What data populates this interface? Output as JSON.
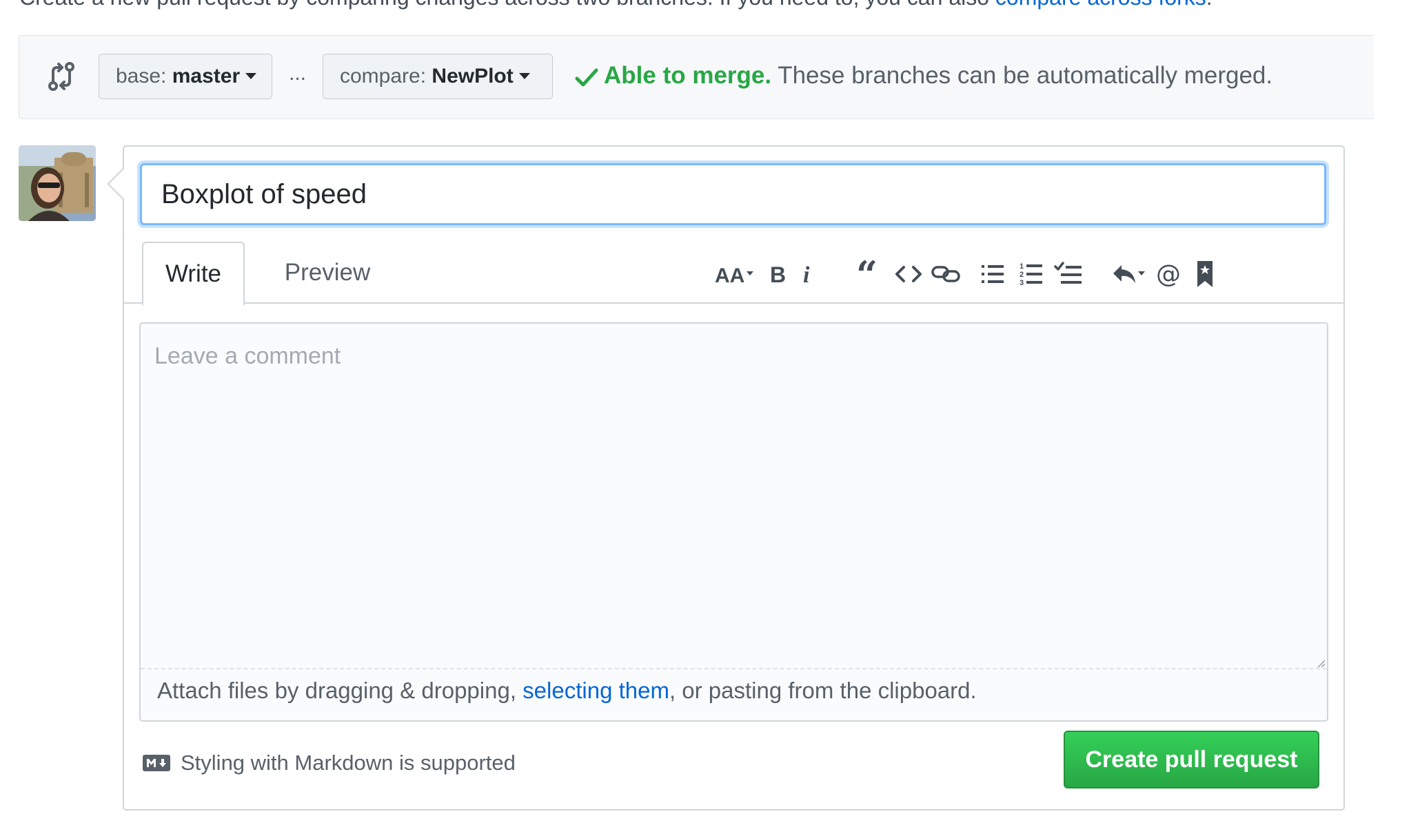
{
  "intro": {
    "text": "Create a new pull request by comparing changes across two branches. If you need to, you can also ",
    "link": "compare across forks",
    "end": "."
  },
  "range": {
    "base_prefix": "base:",
    "base_value": "master",
    "ellipsis": "...",
    "compare_prefix": "compare:",
    "compare_value": "NewPlot",
    "merge_ok": "Able to merge.",
    "merge_desc": "These branches can be automatically merged."
  },
  "form": {
    "title_value": "Boxplot of speed",
    "tabs": [
      "Write",
      "Preview"
    ],
    "toolbar": [
      "header-icon",
      "bold-icon",
      "italic-icon",
      "quote-icon",
      "code-icon",
      "link-icon",
      "unordered-list-icon",
      "ordered-list-icon",
      "task-list-icon",
      "reply-icon",
      "mention-icon",
      "reference-icon"
    ],
    "comment_placeholder": "Leave a comment",
    "attach_pre": "Attach files by dragging & dropping, ",
    "attach_link": "selecting them",
    "attach_post": ", or pasting from the clipboard.",
    "markdown_note": "Styling with Markdown is supported",
    "submit_label": "Create pull request"
  },
  "colors": {
    "accent": "#0366d6",
    "success": "#28a745",
    "focus": "#79b8ff"
  }
}
